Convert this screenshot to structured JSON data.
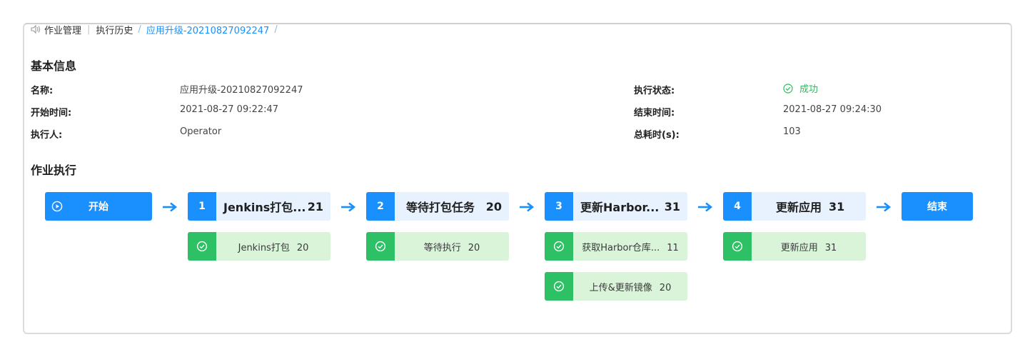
{
  "breadcrumb": {
    "icon": "job-management-icon",
    "items": [
      "作业管理",
      "执行历史",
      "应用升级-20210827092247"
    ],
    "separator": "|",
    "slash": "/"
  },
  "basic_info": {
    "title": "基本信息",
    "name_label": "名称:",
    "name_value": "应用升级-20210827092247",
    "start_label": "开始时间:",
    "start_value": "2021-08-27 09:22:47",
    "executor_label": "执行人:",
    "executor_value": "Operator",
    "status_label": "执行状态:",
    "status_value": "成功",
    "end_label": "结束时间:",
    "end_value": "2021-08-27 09:24:30",
    "duration_label": "总耗时(s):",
    "duration_value": "103"
  },
  "execution": {
    "title": "作业执行",
    "start_label": "开始",
    "end_label": "结束",
    "steps": [
      {
        "num": "1",
        "name": "Jenkins打包...",
        "count": "21",
        "tasks": [
          {
            "name": "Jenkins打包",
            "count": "20"
          }
        ]
      },
      {
        "num": "2",
        "name": "等待打包任务",
        "count": "20",
        "tasks": [
          {
            "name": "等待执行",
            "count": "20"
          }
        ]
      },
      {
        "num": "3",
        "name": "更新Harbor...",
        "count": "31",
        "tasks": [
          {
            "name": "获取Harbor仓库...",
            "count": "11"
          },
          {
            "name": "上传&更新镜像",
            "count": "20"
          }
        ]
      },
      {
        "num": "4",
        "name": "更新应用",
        "count": "31",
        "tasks": [
          {
            "name": "更新应用",
            "count": "31"
          }
        ]
      }
    ]
  },
  "colors": {
    "primary": "#1a90ff",
    "success": "#2dc064",
    "step_bg": "#e7f2fe",
    "task_bg": "#d9f4d9"
  }
}
